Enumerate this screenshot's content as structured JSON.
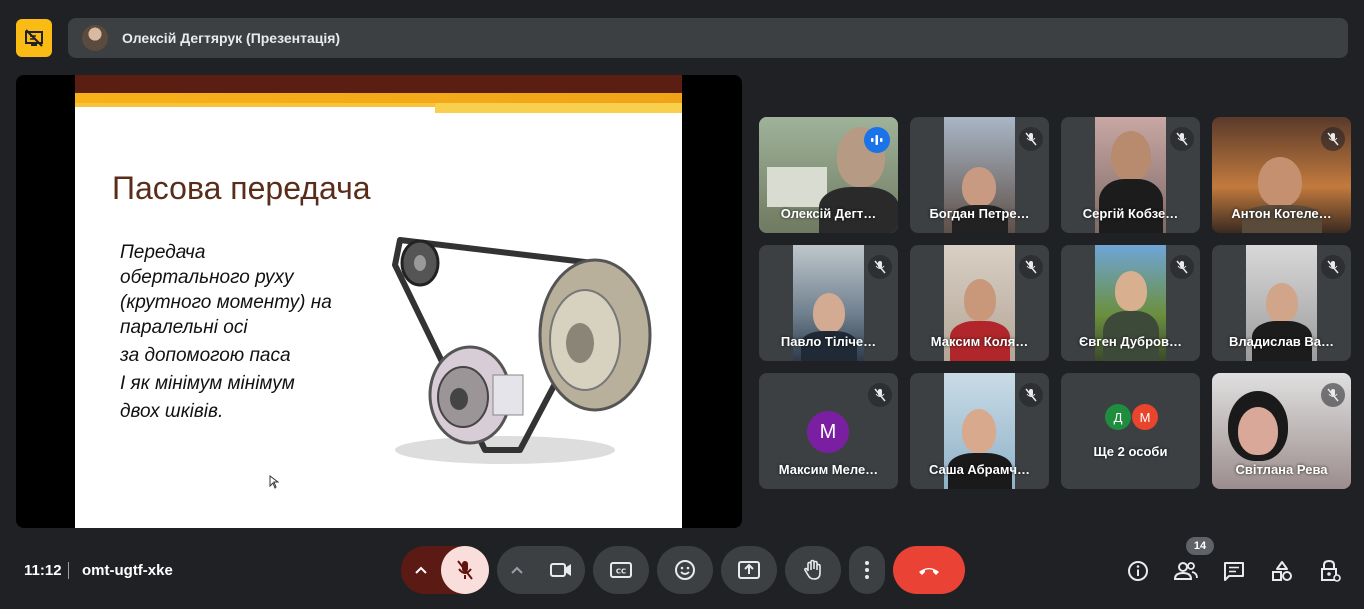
{
  "top_bar": {
    "presenter_label": "Олексій Дегтярук (Презентація)"
  },
  "slide": {
    "title": "Пасова передача",
    "lines": [
      "Передача",
      "обертального руху",
      "(крутного моменту) на",
      "паралельні осі",
      "за допомогою паса",
      "І як мінімум мінімум",
      "двох шківів."
    ]
  },
  "participants": [
    {
      "name": "Олексій Дегт…",
      "speaking": true
    },
    {
      "name": "Богдан Петре…",
      "muted": true
    },
    {
      "name": "Сергій Кобзе…",
      "muted": true
    },
    {
      "name": "Антон Котеле…",
      "muted": true
    },
    {
      "name": "Павло Тіліче…",
      "muted": true
    },
    {
      "name": "Максим Коля…",
      "muted": true
    },
    {
      "name": "Євген Дубров…",
      "muted": true
    },
    {
      "name": "Владислав Ва…",
      "muted": true
    },
    {
      "name": "Максим Меле…",
      "muted": true,
      "initial": "М",
      "color": "#7b1fa2"
    },
    {
      "name": "Саша Абрамч…",
      "muted": true
    },
    {
      "name": "Ще 2 особи",
      "initials": [
        "Д",
        "М"
      ],
      "colors": [
        "#1e8e3e",
        "#e8452c"
      ]
    },
    {
      "name": "Світлана Рева",
      "muted": true
    }
  ],
  "bottom_bar": {
    "time": "11:12",
    "meeting_code": "omt-ugtf-xke",
    "people_count": "14"
  },
  "colors": {
    "accent_yellow": "#f9bb14",
    "end_call_red": "#ea4335",
    "speaking_blue": "#1a73e8"
  }
}
